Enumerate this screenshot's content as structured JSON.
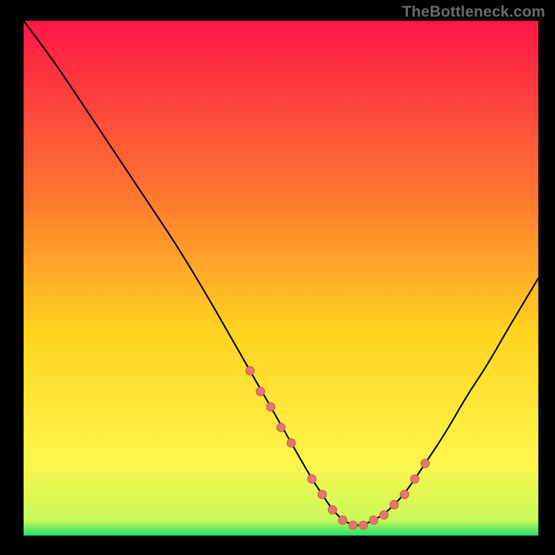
{
  "watermark": "TheBottleneck.com",
  "colors": {
    "bg_black": "#000000",
    "gradient_top": "#ff1648",
    "gradient_mid1": "#ff7a2f",
    "gradient_mid2": "#ffd21f",
    "gradient_mid3": "#fff54a",
    "gradient_bottom": "#22e06a",
    "curve": "#000000",
    "dot_fill": "#e6746f",
    "dot_stroke": "#c85a55"
  },
  "chart_data": {
    "type": "line",
    "title": "",
    "xlabel": "",
    "ylabel": "",
    "xlim": [
      0,
      100
    ],
    "ylim": [
      0,
      100
    ],
    "grid": false,
    "curve": {
      "name": "bottleneck-curve",
      "x": [
        0,
        6,
        12,
        18,
        24,
        30,
        36,
        40,
        44,
        48,
        52,
        56,
        58,
        60,
        62,
        64,
        66,
        70,
        74,
        78,
        82,
        86,
        90,
        94,
        100
      ],
      "y": [
        100,
        92,
        83,
        74,
        65,
        56,
        46,
        39,
        32,
        25,
        18,
        11,
        8,
        5,
        3,
        2,
        2,
        4,
        8,
        14,
        20,
        27,
        33,
        40,
        50
      ]
    },
    "series": [
      {
        "name": "highlight-left-arm",
        "x": [
          44,
          46,
          48,
          50,
          52
        ],
        "y": [
          32,
          28,
          25,
          21,
          18
        ]
      },
      {
        "name": "highlight-valley",
        "x": [
          56,
          58,
          60,
          62,
          64,
          66,
          68
        ],
        "y": [
          11,
          8,
          5,
          3,
          2,
          2,
          3
        ]
      },
      {
        "name": "highlight-right-arm",
        "x": [
          70,
          72,
          74,
          76,
          78
        ],
        "y": [
          4,
          6,
          8,
          11,
          14
        ]
      }
    ]
  }
}
